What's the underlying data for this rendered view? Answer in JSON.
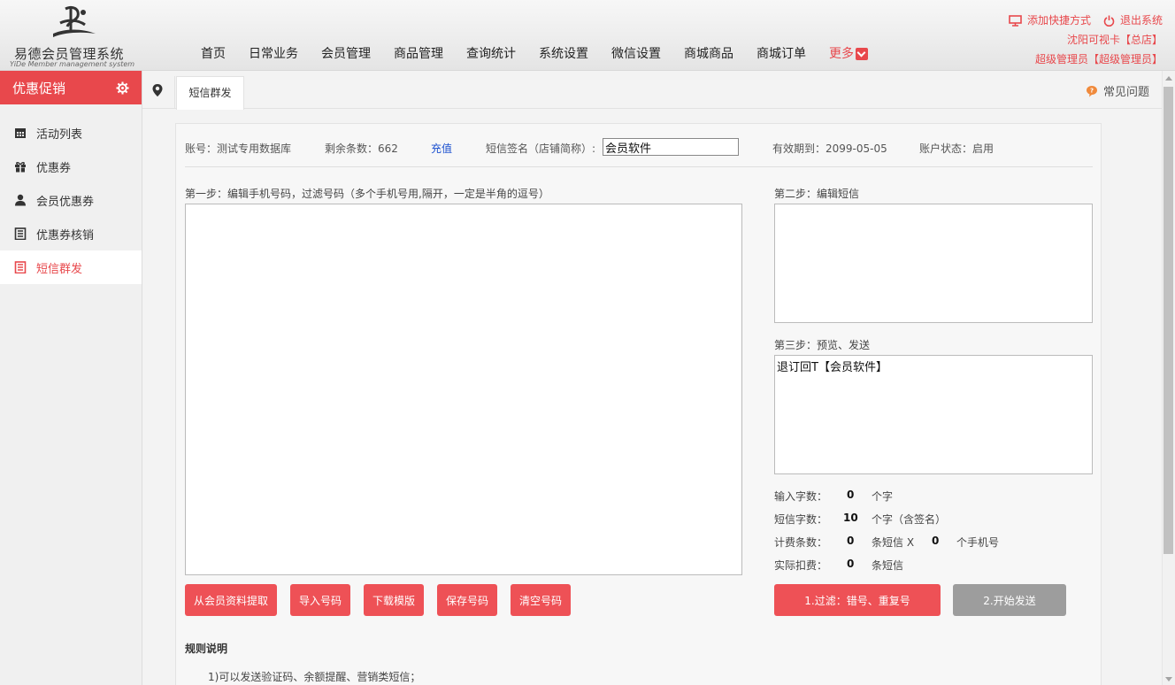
{
  "brand": {
    "title": "易德会员管理系统",
    "subtitle": "YiDe Member management system"
  },
  "nav": {
    "items": [
      "首页",
      "日常业务",
      "会员管理",
      "商品管理",
      "查询统计",
      "系统设置",
      "微信设置",
      "商城商品",
      "商城订单"
    ],
    "more_label": "更多"
  },
  "top_right": {
    "add_shortcut": "添加快捷方式",
    "logout": "退出系统",
    "store": "沈阳可视卡【总店】",
    "user": "超级管理员【超级管理员】"
  },
  "sidebar": {
    "title": "优惠促销",
    "items": [
      {
        "label": "活动列表",
        "icon": "calendar-icon"
      },
      {
        "label": "优惠券",
        "icon": "gift-icon"
      },
      {
        "label": "会员优惠券",
        "icon": "user-icon"
      },
      {
        "label": "优惠券核销",
        "icon": "ledger-icon"
      },
      {
        "label": "短信群发",
        "icon": "list-icon"
      }
    ],
    "active_index": 4
  },
  "tabs": {
    "active": "短信群发",
    "faq": "常见问题"
  },
  "account": {
    "account_label": "账号：测试专用数据库",
    "remaining_label": "剩余条数：662",
    "recharge": "充值",
    "sign_label": "短信签名（店铺简称）:",
    "sign_value": "会员软件",
    "expire_label": "有效期到：2099-05-05",
    "status_label": "账户状态：启用"
  },
  "step1": {
    "label": "第一步：编辑手机号码，过滤号码（多个手机号用,隔开，一定是半角的逗号）",
    "value": ""
  },
  "step2": {
    "label": "第二步：编辑短信",
    "value": ""
  },
  "step3": {
    "label": "第三步：预览、发送",
    "value": "退订回T【会员软件】"
  },
  "stats": {
    "input_chars_label": "输入字数：",
    "input_chars": "0",
    "input_chars_unit": "个字",
    "sms_chars_label": "短信字数：",
    "sms_chars": "10",
    "sms_chars_unit": "个字（含签名）",
    "billing_label": "计费条数：",
    "billing_count": "0",
    "billing_unit": "条短信 X",
    "phone_count": "0",
    "phone_unit": "个手机号",
    "actual_label": "实际扣费：",
    "actual_count": "0",
    "actual_unit": "条短信"
  },
  "buttons": {
    "from_member": "从会员资料提取",
    "import": "导入号码",
    "download_template": "下载模版",
    "save": "保存号码",
    "clear": "清空号码",
    "filter": "1.过滤：错号、重复号",
    "send": "2.开始发送"
  },
  "rules": {
    "title": "规则说明",
    "items": [
      "1)可以发送验证码、余额提醒、营销类短信；"
    ]
  },
  "colors": {
    "accent": "#e8484c",
    "button_red": "#ee5156",
    "button_gray": "#9d9d9d",
    "link": "#1a4fcf"
  }
}
